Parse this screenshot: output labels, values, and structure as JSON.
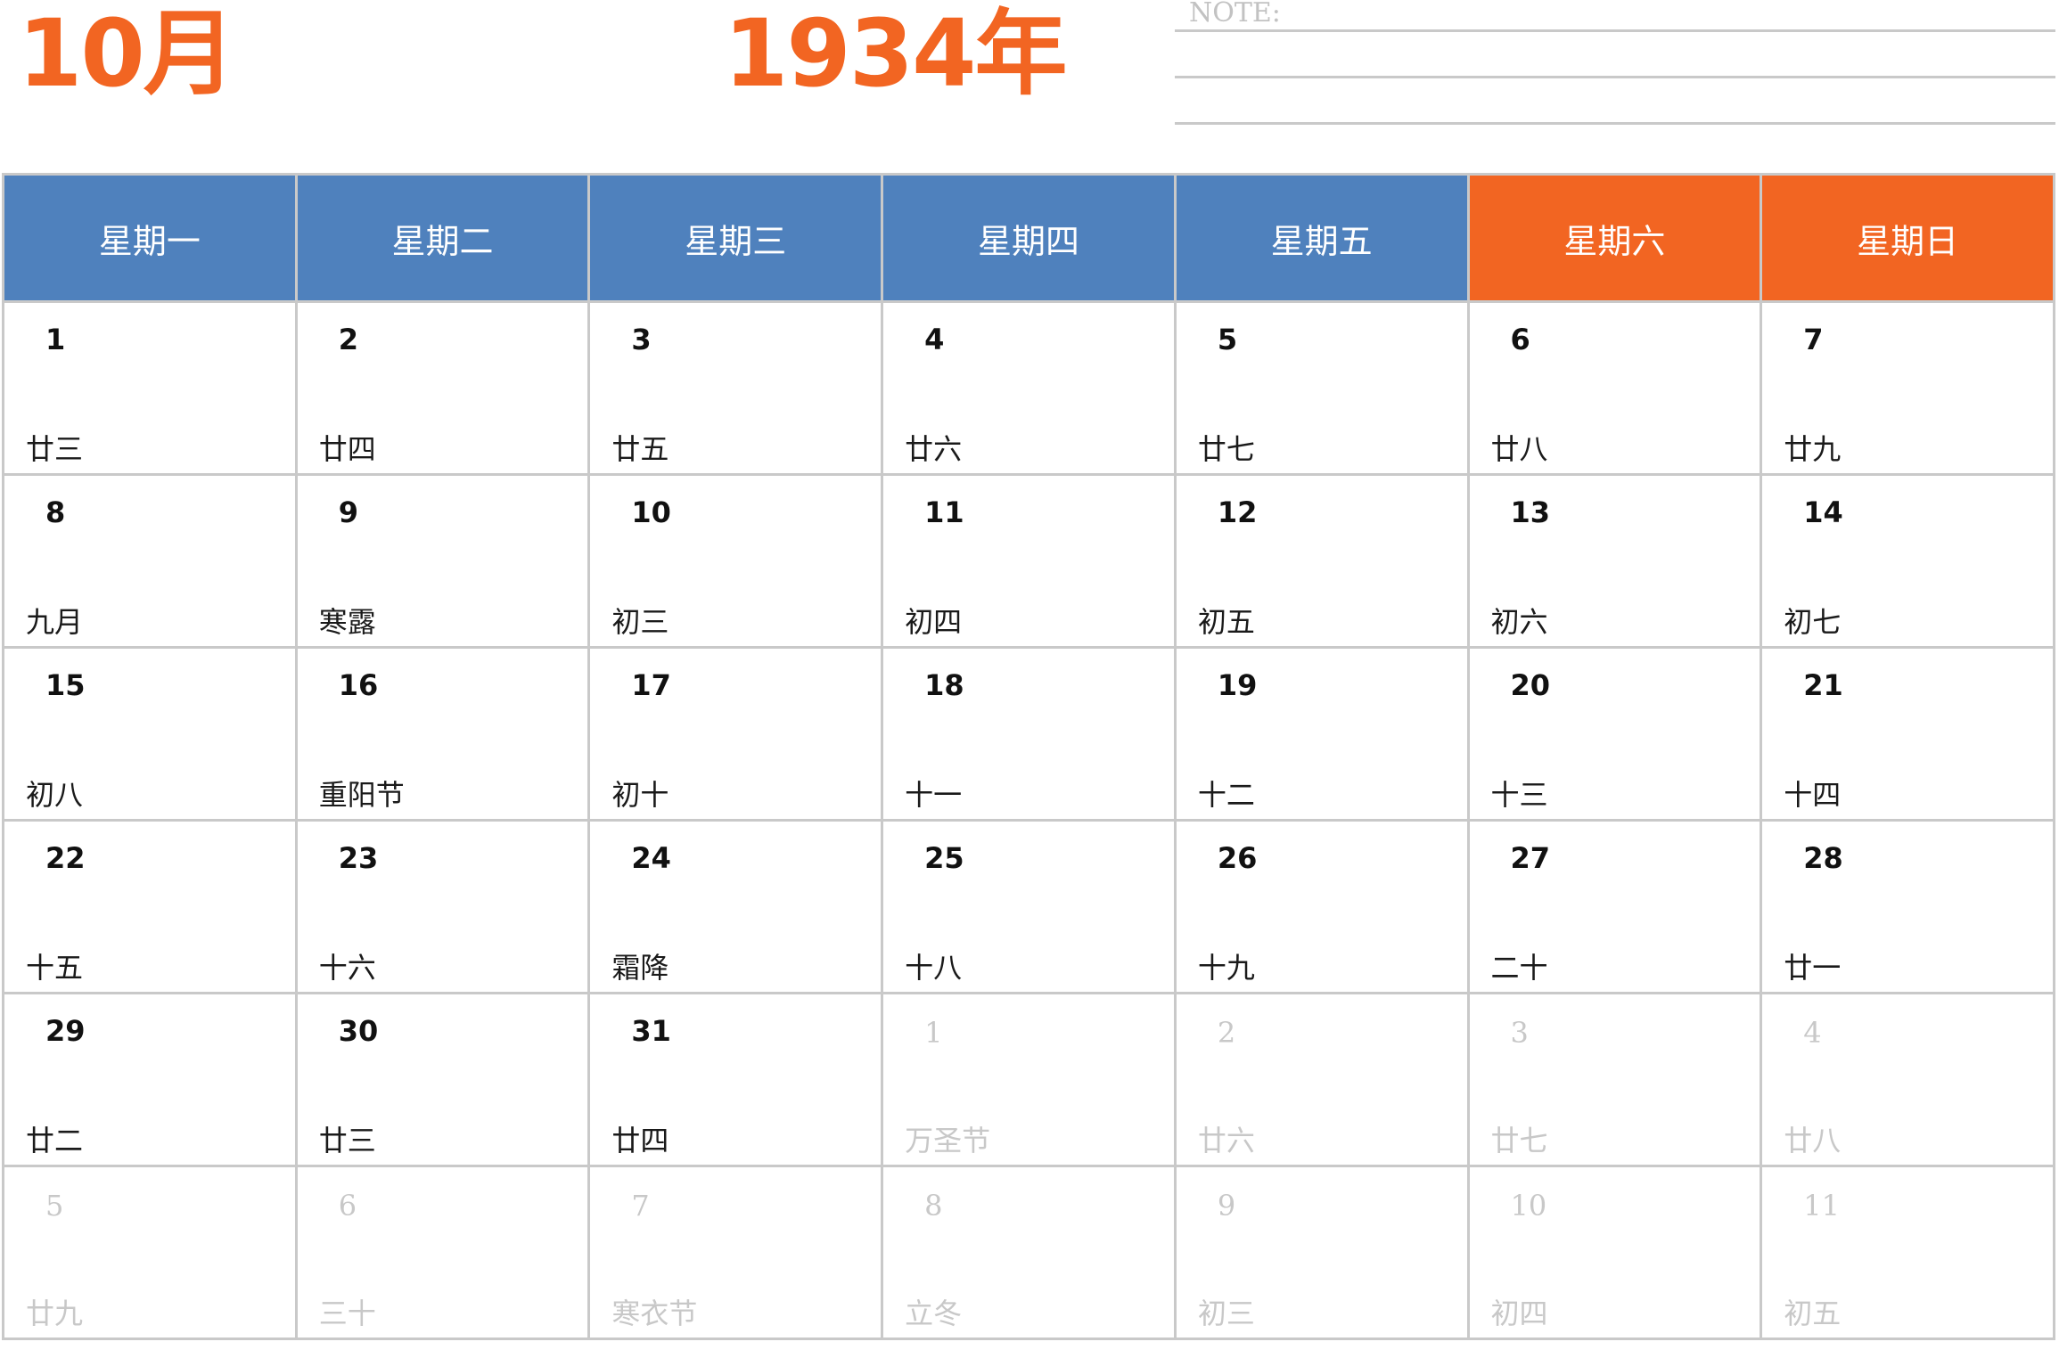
{
  "header": {
    "month": "10月",
    "year": "1934年",
    "note_label": "NOTE:"
  },
  "colors": {
    "accent": "#f26522",
    "weekday_header": "#4f81bd",
    "weekend_header": "#f26522",
    "grid": "#c9c9c9",
    "muted": "#c8c8c8"
  },
  "weekdays": [
    "星期一",
    "星期二",
    "星期三",
    "星期四",
    "星期五",
    "星期六",
    "星期日"
  ],
  "weeks": [
    [
      {
        "day": "1",
        "lunar": "廿三"
      },
      {
        "day": "2",
        "lunar": "廿四"
      },
      {
        "day": "3",
        "lunar": "廿五"
      },
      {
        "day": "4",
        "lunar": "廿六"
      },
      {
        "day": "5",
        "lunar": "廿七"
      },
      {
        "day": "6",
        "lunar": "廿八"
      },
      {
        "day": "7",
        "lunar": "廿九"
      }
    ],
    [
      {
        "day": "8",
        "lunar": "九月"
      },
      {
        "day": "9",
        "lunar": "寒露"
      },
      {
        "day": "10",
        "lunar": "初三"
      },
      {
        "day": "11",
        "lunar": "初四"
      },
      {
        "day": "12",
        "lunar": "初五"
      },
      {
        "day": "13",
        "lunar": "初六"
      },
      {
        "day": "14",
        "lunar": "初七"
      }
    ],
    [
      {
        "day": "15",
        "lunar": "初八"
      },
      {
        "day": "16",
        "lunar": "重阳节"
      },
      {
        "day": "17",
        "lunar": "初十"
      },
      {
        "day": "18",
        "lunar": "十一"
      },
      {
        "day": "19",
        "lunar": "十二"
      },
      {
        "day": "20",
        "lunar": "十三"
      },
      {
        "day": "21",
        "lunar": "十四"
      }
    ],
    [
      {
        "day": "22",
        "lunar": "十五"
      },
      {
        "day": "23",
        "lunar": "十六"
      },
      {
        "day": "24",
        "lunar": "霜降"
      },
      {
        "day": "25",
        "lunar": "十八"
      },
      {
        "day": "26",
        "lunar": "十九"
      },
      {
        "day": "27",
        "lunar": "二十"
      },
      {
        "day": "28",
        "lunar": "廿一"
      }
    ],
    [
      {
        "day": "29",
        "lunar": "廿二"
      },
      {
        "day": "30",
        "lunar": "廿三"
      },
      {
        "day": "31",
        "lunar": "廿四"
      },
      {
        "day": "1",
        "lunar": "万圣节",
        "other": true
      },
      {
        "day": "2",
        "lunar": "廿六",
        "other": true
      },
      {
        "day": "3",
        "lunar": "廿七",
        "other": true
      },
      {
        "day": "4",
        "lunar": "廿八",
        "other": true
      }
    ],
    [
      {
        "day": "5",
        "lunar": "廿九",
        "other": true
      },
      {
        "day": "6",
        "lunar": "三十",
        "other": true
      },
      {
        "day": "7",
        "lunar": "寒衣节",
        "other": true
      },
      {
        "day": "8",
        "lunar": "立冬",
        "other": true
      },
      {
        "day": "9",
        "lunar": "初三",
        "other": true
      },
      {
        "day": "10",
        "lunar": "初四",
        "other": true
      },
      {
        "day": "11",
        "lunar": "初五",
        "other": true
      }
    ]
  ]
}
